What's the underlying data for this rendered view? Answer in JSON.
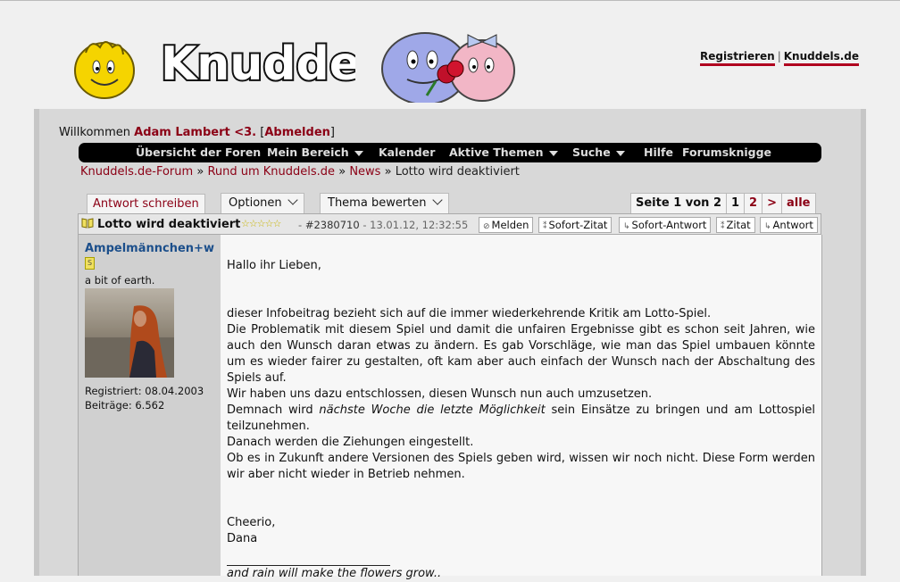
{
  "header": {
    "logo_text": "Knuddels",
    "links": [
      "Registrieren",
      "Knuddels.de"
    ],
    "separator": "|"
  },
  "welcome": {
    "prefix": "Willkommen",
    "user": "Adam Lambert <3.",
    "bracket_open": "[",
    "logout": "Abmelden",
    "bracket_close": "]"
  },
  "nav": {
    "items": [
      "Übersicht der Foren",
      "Mein Bereich",
      "Kalender",
      "Aktive Themen",
      "Suche",
      "Hilfe",
      "Forumsknigge"
    ]
  },
  "breadcrumb": {
    "items": [
      "Knuddels.de-Forum",
      "Rund um Knuddels.de",
      "News"
    ],
    "current": "Lotto wird deaktiviert",
    "sep": "»"
  },
  "actions": {
    "reply": "Antwort schreiben",
    "options": "Optionen",
    "rate": "Thema bewerten"
  },
  "pager": {
    "label": "Seite 1 von 2",
    "pages": [
      "1",
      "2"
    ],
    "next": ">",
    "all": "alle"
  },
  "post": {
    "title": "Lotto wird deaktiviert",
    "stars": "☆☆☆☆☆",
    "id": "#2380710",
    "dash": "-",
    "date": "13.01.12, 12:32:55",
    "buttons": [
      "Melden",
      "Sofort-Zitat",
      "Sofort-Antwort",
      "Zitat",
      "Antwort"
    ],
    "author": "Ampelmännchen+w",
    "badge": "S",
    "tagline": "a bit of earth.",
    "registered": "Registriert: 08.04.2003",
    "posts": "Beiträge: 6.562",
    "greeting": "Hallo ihr Lieben,",
    "para1": "dieser Infobeitrag bezieht sich auf die immer wiederkehrende Kritik am Lotto-Spiel.",
    "para2": "Die Problematik mit diesem Spiel und damit die unfairen Ergebnisse gibt es schon seit Jahren, wie auch den Wunsch daran etwas zu ändern. Es gab Vorschläge, wie man das Spiel umbauen könnte um es wieder fairer zu gestalten, oft kam aber auch einfach der Wunsch nach der Abschaltung des Spiels auf.",
    "para3": "Wir haben uns dazu entschlossen, diesen Wunsch nun auch umzusetzen.",
    "para4_pre": "Demnach wird",
    "para4_em": "nächste Woche die letzte Möglichkeit",
    "para4_post": "sein Einsätze zu bringen und am Lottospiel teilzunehmen.",
    "para5": "Danach werden die Ziehungen eingestellt.",
    "para6": "Ob es in Zukunft andere Versionen des Spiels geben wird, wissen wir noch nicht. Diese Form werden wir aber nicht wieder in Betrieb nehmen.",
    "closing1": "Cheerio,",
    "closing2": "Dana",
    "signature": "and rain will make the flowers grow.."
  },
  "colors": {
    "accent_red": "#8b0015",
    "nav_bg": "#000000",
    "username_blue": "#1c4f8b"
  }
}
